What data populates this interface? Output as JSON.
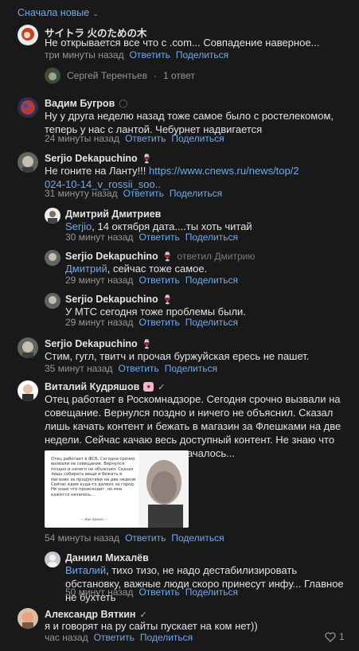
{
  "sort_label": "Сначала новые",
  "labels": {
    "reply": "Ответить",
    "share": "Поделиться"
  },
  "comments": [
    {
      "author": "サイトラ 火のための木",
      "text": "Не открывается все что с .com... Совпадение наверное...",
      "time": "три минуты назад",
      "thread": {
        "author": "Сергей Терентьев",
        "dot": "·",
        "replies": "1 ответ"
      }
    },
    {
      "author": "Вадим Бугров",
      "text": "Ну у друга неделю назад тоже самое было с ростелекомом, теперь у нас с лантой. Чебурнет надвигается",
      "time": "24 минуты назад"
    },
    {
      "author": "Serjio Dekapuchino",
      "text": "Не гоните на Ланту!!! ",
      "link": "https://www.cnews.ru/news/top/2024-10-14_v_rossii_soo..",
      "time": "31 минуту назад"
    },
    {
      "author": "Дмитрий Дмитриев",
      "mention": "Serjio",
      "text": ", 14 октября дата....ты хоть читай",
      "time": "30 минут назад"
    },
    {
      "author": "Serjio Dekapuchino",
      "reply_to": "ответил Дмитрию",
      "mention": "Дмитрий",
      "text": ", сейчас тоже самое.",
      "time": "29 минут назад"
    },
    {
      "author": "Serjio Dekapuchino",
      "text": "У МТС сегодня тоже проблемы были.",
      "time": "29 минут назад"
    },
    {
      "author": "Serjio Dekapuchino",
      "text": "Стим, гугл, твитч и прочая буржуйская ересь не пашет.",
      "time": "35 минут назад"
    },
    {
      "author": "Виталий Кудряшов",
      "text": "Отец работает в Роскомнадзоре. Сегодня срочно вызвали на совещание. Вернулся поздно и ничего не объяснил. Сказал лишь качать контент и бежать в магазин за Флешками на две недели. Сейчас качаю весь доступный контент. Не знаю что происходит, но мне кажется началось...",
      "time": "54 минуты назад",
      "image": {
        "quote": "Отец работает в ФСБ. Сегодня срочно вызвали на совещание. Вернулся поздно и ничего не объяснил. Сказал лишь собирать вещи и бежать в магазин за продуктами на две недели. Сейчас едем куда-то далеко за город. Не знаю что происходит, но мне кажется началось...",
        "signature": "— Жак Фреско —"
      }
    },
    {
      "author": "Даниил Михалёв",
      "mention": "Виталий",
      "text": ", тихо тизо, не надо дестабилизировать обстановку, важные люди скоро принесут инфу... Главное не бухтеть",
      "time": "50 минут назад"
    },
    {
      "author": "Александр Вяткин",
      "text": "я и говорят на ру сайты пускает на ком нет))",
      "time": "час назад",
      "likes": "1"
    }
  ],
  "colors": {
    "background": "#19191a",
    "link": "#71aaeb",
    "text": "#e1e3e6",
    "muted": "#939699"
  }
}
